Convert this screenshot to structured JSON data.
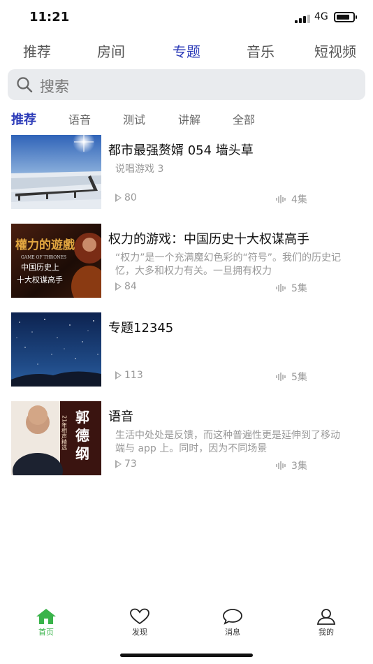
{
  "status": {
    "time": "11:21",
    "network": "4G"
  },
  "top_tabs": [
    {
      "label": "推荐",
      "active": false
    },
    {
      "label": "房间",
      "active": false
    },
    {
      "label": "专题",
      "active": true
    },
    {
      "label": "音乐",
      "active": false
    },
    {
      "label": "短视频",
      "active": false
    }
  ],
  "search": {
    "placeholder": "搜索"
  },
  "sub_tabs": [
    {
      "label": "推荐",
      "active": true
    },
    {
      "label": "语音",
      "active": false
    },
    {
      "label": "测试",
      "active": false
    },
    {
      "label": "讲解",
      "active": false
    },
    {
      "label": "全部",
      "active": false
    }
  ],
  "items": [
    {
      "title": "都市最强赘婿 054 墙头草",
      "desc": "说唱游戏 3",
      "plays": "80",
      "episodes": "4集",
      "thumb_alt": "snowy-lake-sunrise"
    },
    {
      "title": "权力的游戏：中国历史十大权谋高手",
      "desc": "“权力”是一个充满魔幻色彩的“符号”。我们的历史记忆，大多和权力有关。一旦拥有权力",
      "plays": "84",
      "episodes": "5集",
      "thumb_alt": "game-of-thrones-cover",
      "thumb_text": {
        "line1": "權力的遊戲",
        "line2": "GAME OF THRONES",
        "line3": "中国历史上",
        "line4": "十大权谋高手"
      }
    },
    {
      "title": "专题12345",
      "desc": "",
      "plays": "113",
      "episodes": "5集",
      "thumb_alt": "starry-night-sky"
    },
    {
      "title": "语音",
      "desc": "生活中处处是反馈，而这种普遍性更是延伸到了移动端与 app 上。同时，因为不同场景",
      "plays": "73",
      "episodes": "3集",
      "thumb_alt": "guo-degang-cover",
      "thumb_text": {
        "big": "郭德纲",
        "side": "21年相声精选"
      }
    }
  ],
  "bottom_nav": [
    {
      "label": "首页",
      "icon": "home-icon",
      "active": true
    },
    {
      "label": "发现",
      "icon": "heart-icon",
      "active": false
    },
    {
      "label": "消息",
      "icon": "chat-bubble-icon",
      "active": false
    },
    {
      "label": "我的",
      "icon": "user-icon",
      "active": false
    }
  ],
  "colors": {
    "accent": "#2c3bb8",
    "nav_active": "#39b34a",
    "muted": "#999999",
    "search_bg": "#e9ebee"
  }
}
